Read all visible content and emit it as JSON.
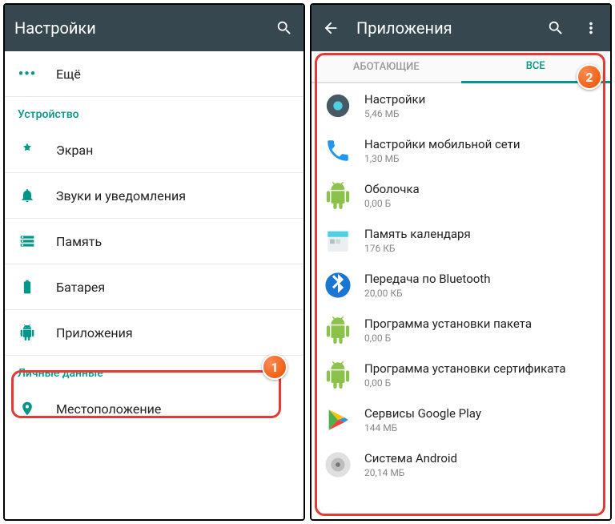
{
  "left": {
    "title": "Настройки",
    "more": "Ещё",
    "section_device": "Устройство",
    "items": [
      {
        "label": "Экран",
        "icon": "display"
      },
      {
        "label": "Звуки и уведомления",
        "icon": "bell"
      },
      {
        "label": "Память",
        "icon": "storage"
      },
      {
        "label": "Батарея",
        "icon": "battery"
      },
      {
        "label": "Приложения",
        "icon": "apps"
      }
    ],
    "section_personal": "Личные данные",
    "personal": [
      {
        "label": "Местоположение",
        "icon": "location"
      }
    ],
    "badge": "1"
  },
  "right": {
    "title": "Приложения",
    "tabs": {
      "running": "АБОТАЮЩИЕ",
      "all": "ВСЕ"
    },
    "apps": [
      {
        "name": "Настройки",
        "size": "5,46 МБ",
        "icon": "settings"
      },
      {
        "name": "Настройки мобильной сети",
        "size": "1,30 МБ",
        "icon": "phone"
      },
      {
        "name": "Оболочка",
        "size": "0,00 Б",
        "icon": "android"
      },
      {
        "name": "Память календаря",
        "size": "176 КБ",
        "icon": "calendar"
      },
      {
        "name": "Передача по Bluetooth",
        "size": "20,00 КБ",
        "icon": "bluetooth"
      },
      {
        "name": "Программа установки пакета",
        "size": "0,00 Б",
        "icon": "android"
      },
      {
        "name": "Программа установки сертификата",
        "size": "0,00 Б",
        "icon": "android"
      },
      {
        "name": "Сервисы Google Play",
        "size": "144 МБ",
        "icon": "play"
      },
      {
        "name": "Система Android",
        "size": "20,14 МБ",
        "icon": "system"
      }
    ],
    "badge": "2"
  }
}
